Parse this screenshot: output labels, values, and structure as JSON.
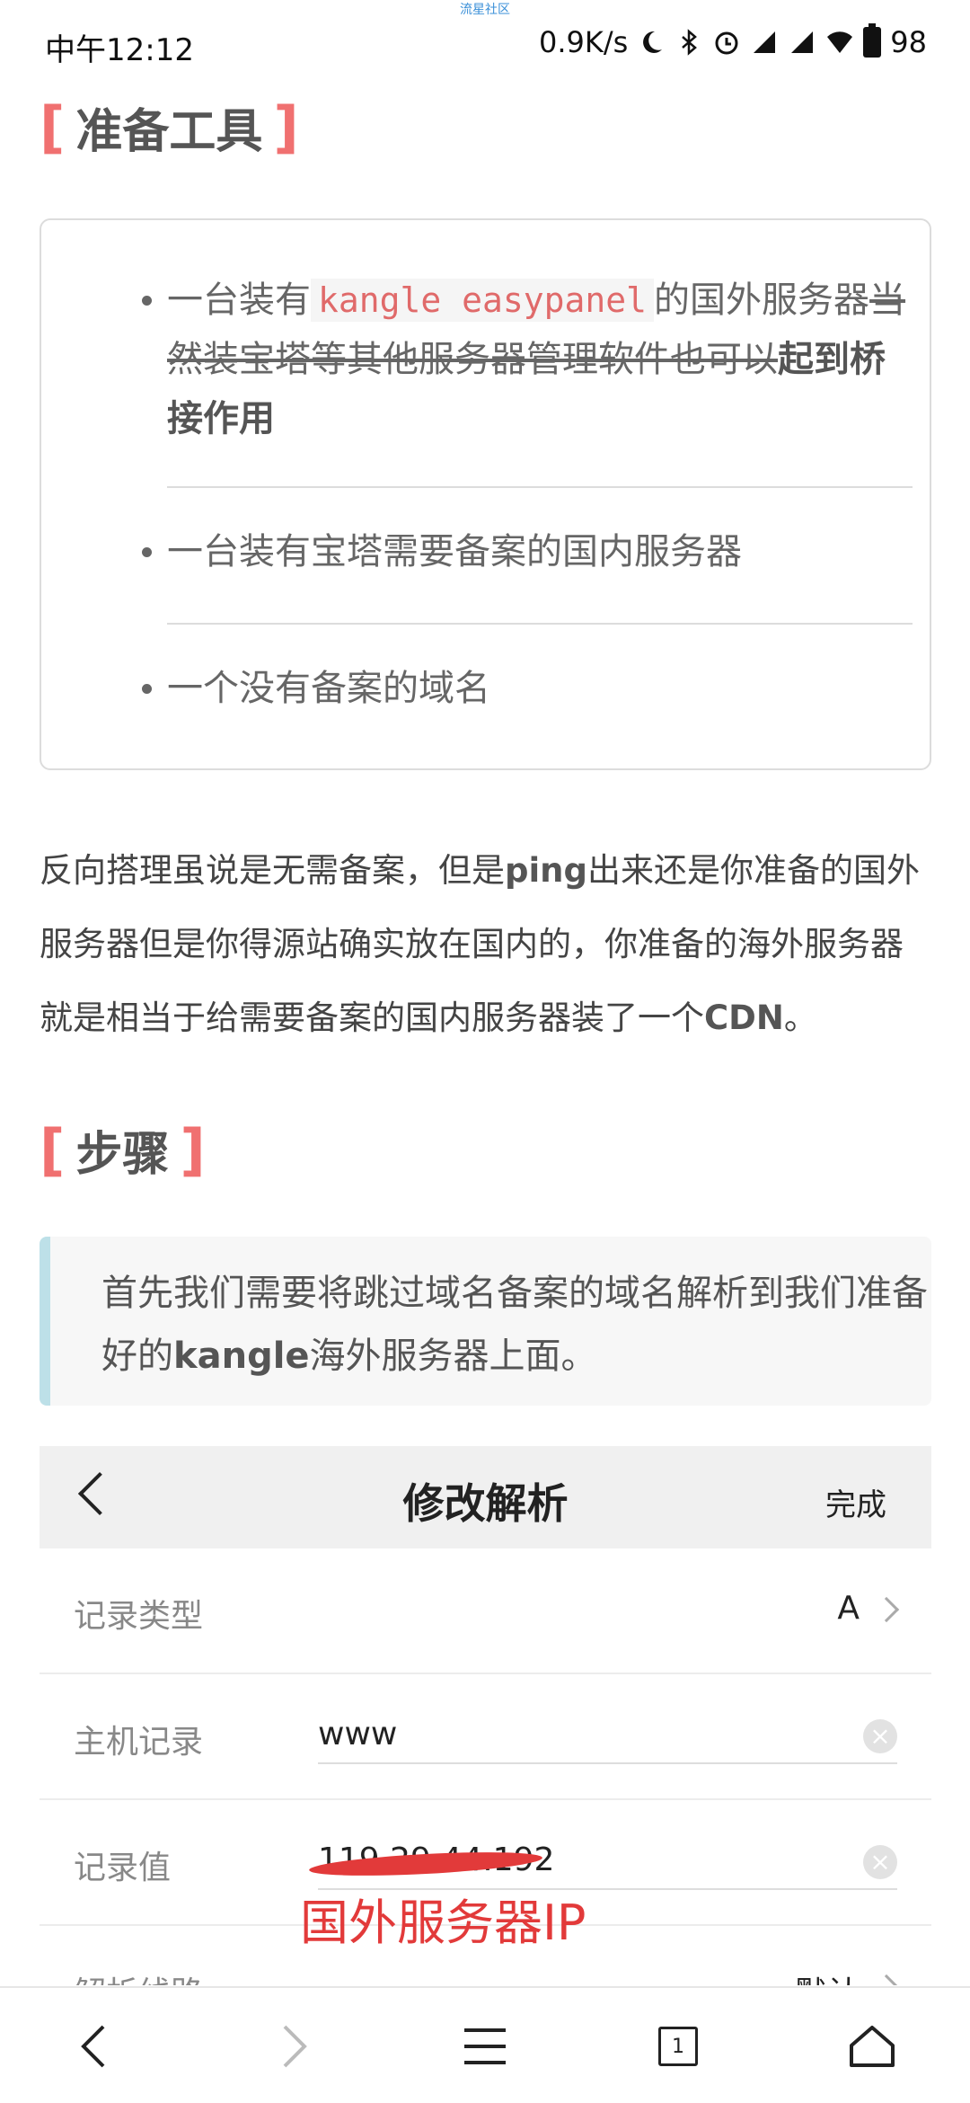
{
  "status_bar": {
    "time": "中午12:12",
    "network_speed": "0.9K/s",
    "battery": "98",
    "watermark": "流星社区"
  },
  "section_tools": {
    "title": "准备工具",
    "items": [
      {
        "prefix": "一台装有",
        "code": "kangle easypanel",
        "mid": "的国外服务器",
        "strike": "当然装宝塔等其他服务器管理软件也可以",
        "bold": "起到桥接作用"
      },
      {
        "text": "一台装有宝塔需要备案的国内服务器"
      },
      {
        "text": "一个没有备案的域名"
      }
    ]
  },
  "paragraph": {
    "p1": "反向搭理虽说是无需备案，但是",
    "b1": "ping",
    "p2": "出来还是你准备的国外服务器但是你得源站确实放在国内的，你准备的海外服务器就是相当于给需要备案的国内服务器装了一个",
    "b2": "CDN",
    "p3": "。"
  },
  "section_steps": {
    "title": "步骤"
  },
  "quote": {
    "p1": "首先我们需要将跳过域名备案的域名解析到我们准备好的",
    "b1": "kangle",
    "p2": "海外服务器上面。"
  },
  "embedded_screen": {
    "title": "修改解析",
    "done": "完成",
    "rows": [
      {
        "label": "记录类型",
        "value": "A"
      },
      {
        "label": "主机记录",
        "value": "www"
      },
      {
        "label": "记录值",
        "value": "119.29.44.192"
      },
      {
        "label": "解析线路",
        "value": "默认"
      }
    ],
    "annotation": "国外服务器IP"
  },
  "nav": {
    "tabs_count": "1"
  }
}
